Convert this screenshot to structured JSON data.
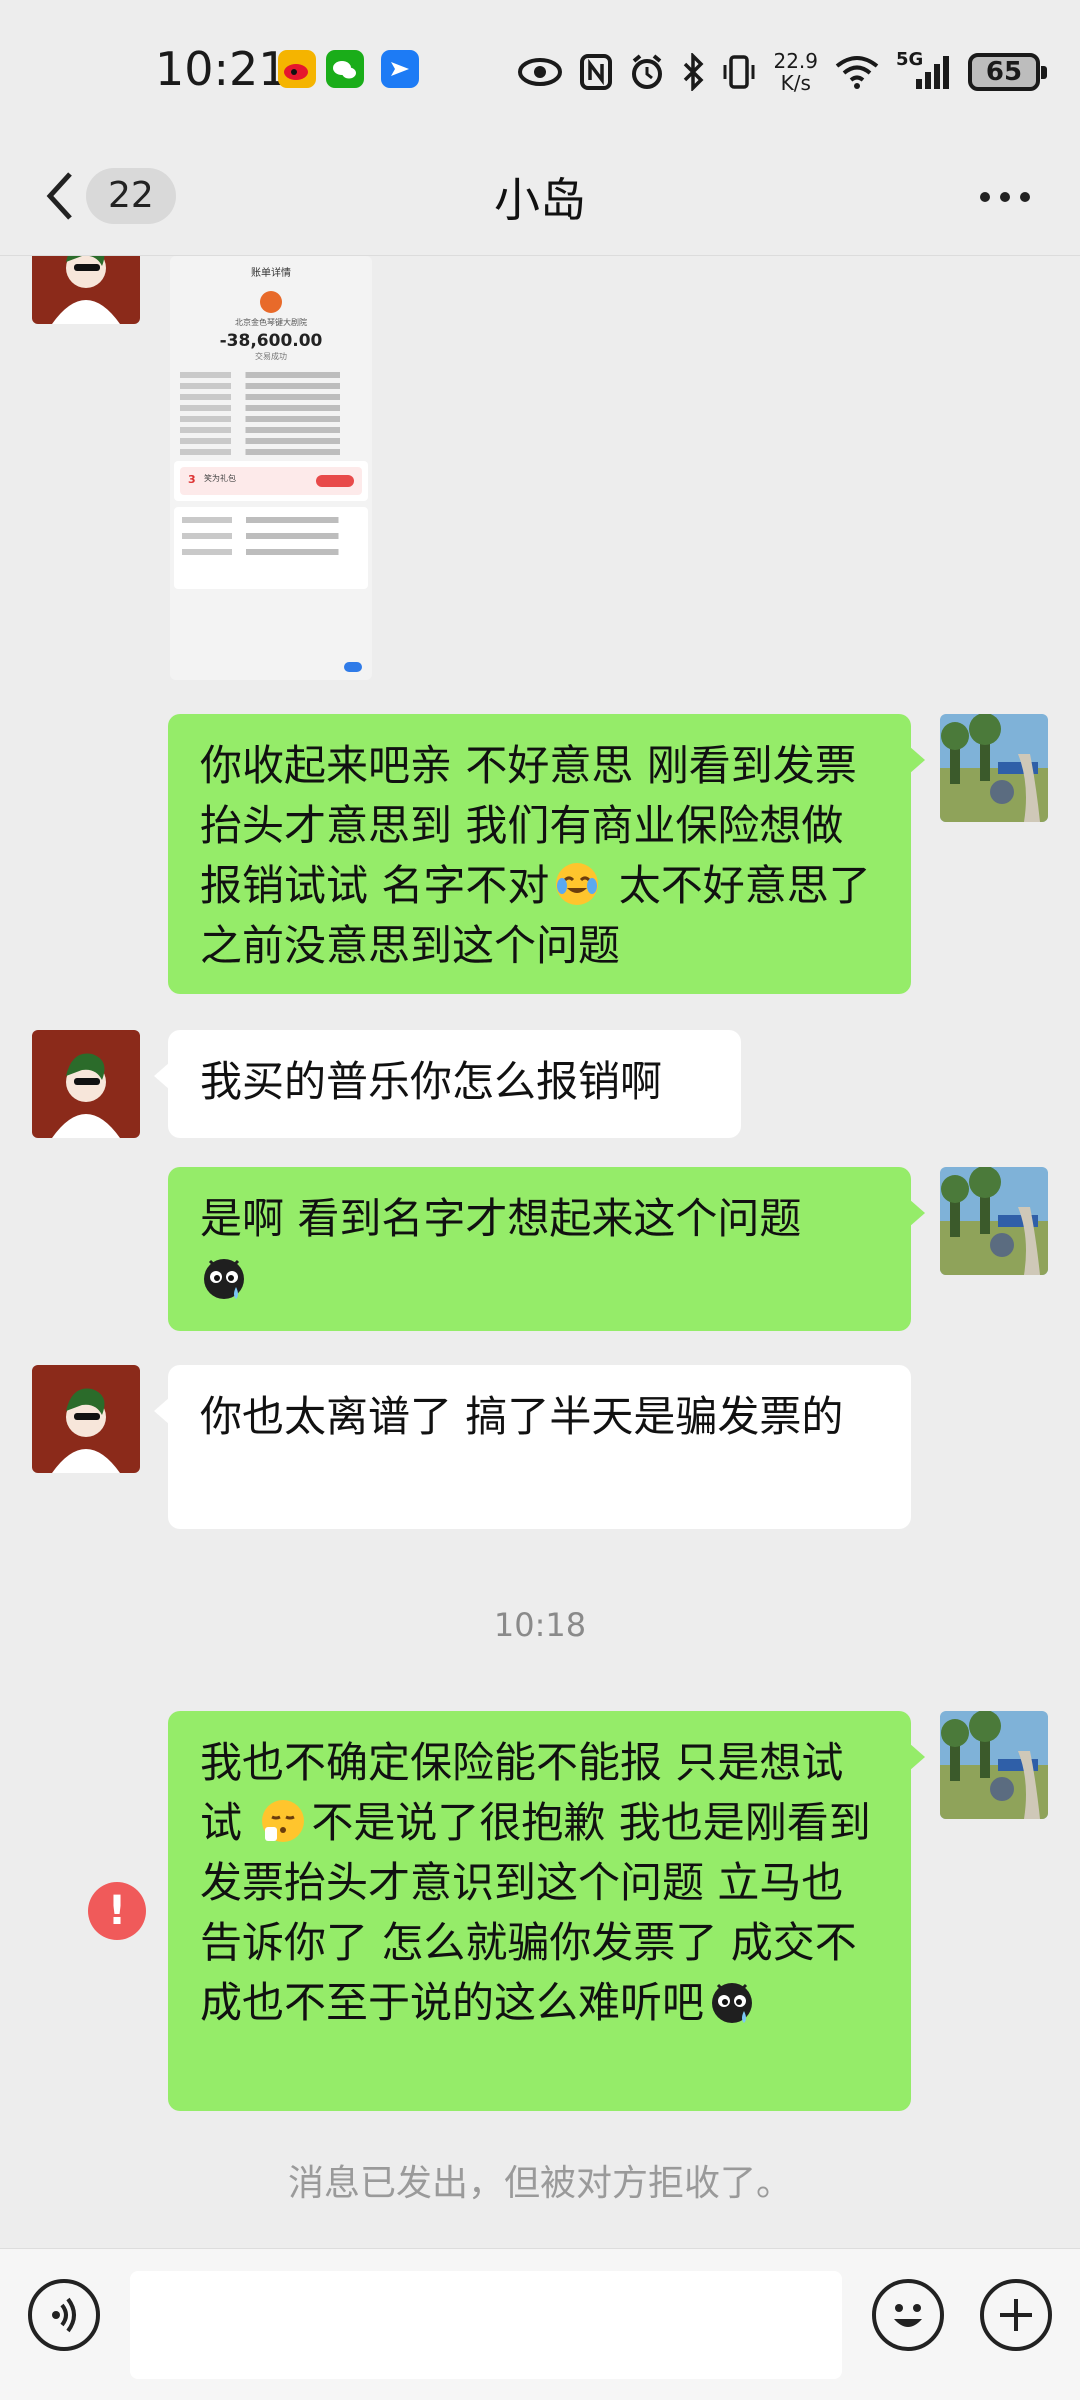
{
  "status_bar": {
    "time": "10:21",
    "network_speed_value": "22.9",
    "network_speed_unit": "K/s",
    "signal_label": "5G",
    "battery": "65"
  },
  "header": {
    "unread_count": "22",
    "title": "小岛"
  },
  "receipt_image": {
    "header": "账单详情",
    "merchant": "北京金色琴键大剧院",
    "amount": "-38,600.00",
    "status": "交易成功",
    "promo_count": "3",
    "promo_label": "笑为礼包"
  },
  "messages": [
    {
      "id": "m1",
      "direction": "out",
      "text_parts": [
        "你收起来吧亲 不好意思 刚看到发票抬头才意思到  我们有商业保险想做报销试试 名字不对",
        " 太不好意思了之前没意思到这个问题"
      ],
      "emoji": "crying-laughing-face"
    },
    {
      "id": "m2",
      "direction": "in",
      "text": "我买的普乐你怎么报销啊"
    },
    {
      "id": "m3",
      "direction": "out",
      "text": "是啊 看到名字才想起来这个问题",
      "emoji": "sweat-face"
    },
    {
      "id": "m4",
      "direction": "in",
      "text": "你也太离谱了 搞了半天是骗发票的"
    },
    {
      "id": "m5",
      "direction": "out",
      "text_parts": [
        " 我也不确定保险能不能报 只是想试试 ",
        "不是说了很抱歉 我也是刚看到发票抬头才意识到这个问题 立马也告诉你了  怎么就骗你发票了  成交不成也不至于说的这么难听吧"
      ],
      "emoji": "pouting-face",
      "emoji_end": "sweat-face",
      "failed": true
    }
  ],
  "timestamp": "10:18",
  "system_note": "消息已发出，但被对方拒收了。",
  "error_mark": "!",
  "input": {
    "placeholder": ""
  },
  "colors": {
    "outgoing_bubble": "#95ec69",
    "incoming_bubble": "#ffffff",
    "background": "#ededed",
    "error": "#f05a5a"
  }
}
